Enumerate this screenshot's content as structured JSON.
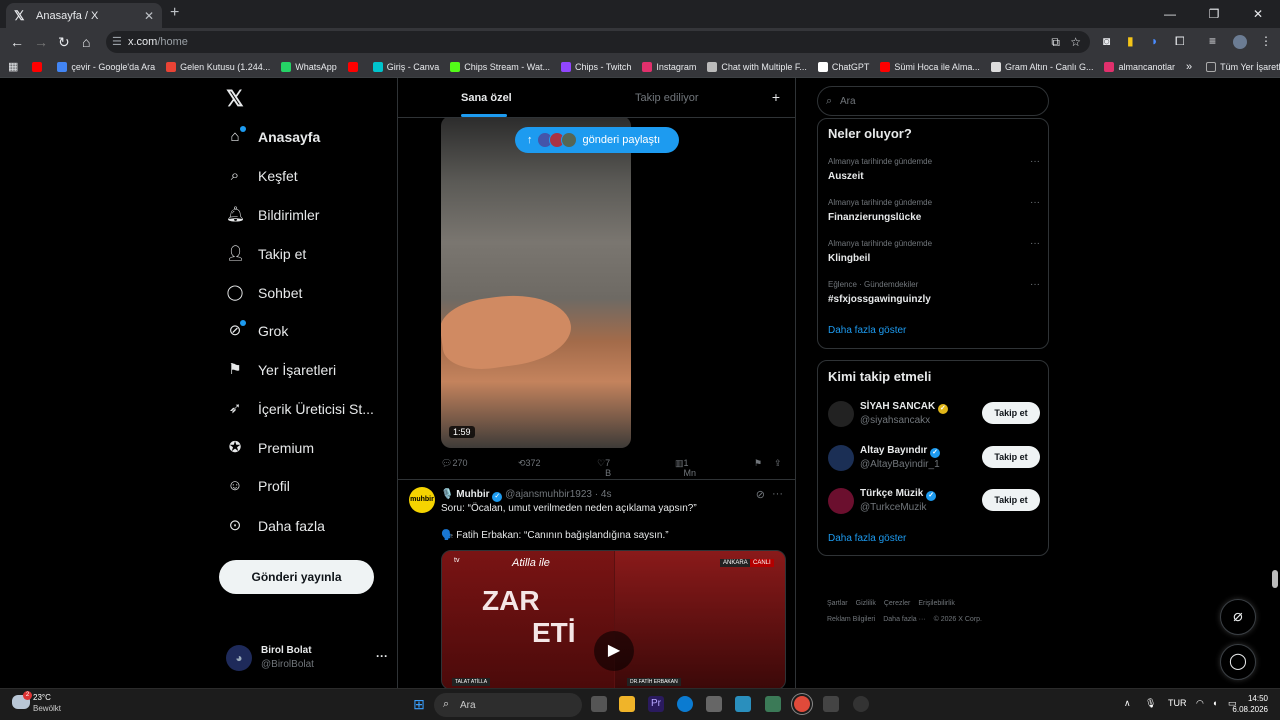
{
  "browser": {
    "tab_title": "Anasayfa / X",
    "url_host": "x.com",
    "url_path": "/home",
    "bookmarks": [
      {
        "label": "",
        "color": "#ff0000"
      },
      {
        "label": "çevir - Google'da Ara",
        "color": "#4285f4"
      },
      {
        "label": "Gelen Kutusu (1.244...",
        "color": "#ea4335"
      },
      {
        "label": "WhatsApp",
        "color": "#25d366"
      },
      {
        "label": "",
        "color": "#ff0000"
      },
      {
        "label": "Giriş - Canva",
        "color": "#00c4cc"
      },
      {
        "label": "Chips Stream - Wat...",
        "color": "#53fc18"
      },
      {
        "label": "Chips - Twitch",
        "color": "#9146ff"
      },
      {
        "label": "Instagram",
        "color": "#e1306c"
      },
      {
        "label": "Chat with Multiple F...",
        "color": "#bbbbbb"
      },
      {
        "label": "ChatGPT",
        "color": "#ffffff"
      },
      {
        "label": "Sümi Hoca ile Alma...",
        "color": "#ff0000"
      },
      {
        "label": "Gram Altın - Canlı G...",
        "color": "#dddddd"
      },
      {
        "label": "almancanotlar",
        "color": "#e1306c"
      }
    ],
    "all_bookmarks_label": "Tüm Yer İşaretleri"
  },
  "nav": {
    "items": [
      {
        "label": "Anasayfa",
        "icon": "home-icon"
      },
      {
        "label": "Keşfet",
        "icon": "search-icon"
      },
      {
        "label": "Bildirimler",
        "icon": "bell-icon"
      },
      {
        "label": "Takip et",
        "icon": "person-add-icon"
      },
      {
        "label": "Sohbet",
        "icon": "chat-icon"
      },
      {
        "label": "Grok",
        "icon": "grok-icon"
      },
      {
        "label": "Yer İşaretleri",
        "icon": "bookmark-icon"
      },
      {
        "label": "İçerik Üreticisi St...",
        "icon": "rocket-icon"
      },
      {
        "label": "Premium",
        "icon": "premium-icon"
      },
      {
        "label": "Profil",
        "icon": "profile-icon"
      },
      {
        "label": "Daha fazla",
        "icon": "more-icon"
      }
    ],
    "post_button": "Gönderi yayınla",
    "user": {
      "name": "Birol Bolat",
      "handle": "@BirolBolat"
    }
  },
  "feed": {
    "tabs": [
      "Sana özel",
      "Takip ediliyor"
    ],
    "new_posts_pill": "gönderi paylaştı",
    "video1_duration": "1:59",
    "actions": {
      "replies": "270",
      "reposts": "372",
      "likes": "7 B",
      "views": "1 Mn"
    },
    "post2": {
      "avatar_text": "muhbir",
      "author": "Muhbir",
      "handle": "@ajansmuhbir1923",
      "time": "· 4s",
      "line1": "Soru: “Öcalan, umut verilmeden neden açıklama yapsın?”",
      "line2": "🗣️ Fatih Erbakan: “Canının bağışlandığına saysın.”",
      "video_overlay_sub": "Atilla ile",
      "video_overlay_big": "ZAR",
      "video_overlay_big2": "ETİ",
      "video_tag_left": "ANKARA",
      "video_tag_right": "CANLI",
      "name_left": "TALAT ATİLLA",
      "name_right": "DR.FATİH ERBAKAN"
    }
  },
  "sidebar": {
    "search_placeholder": "Ara",
    "trends_title": "Neler oluyor?",
    "trends": [
      {
        "category": "Almanya tarihinde gündemde",
        "topic": "Auszeit"
      },
      {
        "category": "Almanya tarihinde gündemde",
        "topic": "Finanzierungslücke"
      },
      {
        "category": "Almanya tarihinde gündemde",
        "topic": "Klingbeil"
      },
      {
        "category": "Eğlence · Gündemdekiler",
        "topic": "#sfxjossgawinguinzly"
      }
    ],
    "show_more": "Daha fazla göster",
    "who_to_follow_title": "Kimi takip etmeli",
    "suggestions": [
      {
        "name": "SİYAH SANCAK",
        "handle": "@siyahsancakx",
        "badge": "gold",
        "avatar_color": "#222"
      },
      {
        "name": "Altay Bayındır",
        "handle": "@AltayBayindir_1",
        "badge": "blue",
        "avatar_color": "#1b2f55"
      },
      {
        "name": "Türkçe Müzik",
        "handle": "@TurkceMuzik",
        "badge": "blue",
        "avatar_color": "#6b0f2e"
      }
    ],
    "follow_label": "Takip et",
    "footer_links": [
      "Şartlar",
      "Gizlilik",
      "Çerezler",
      "Erişilebilirlik",
      "Reklam Bilgileri",
      "Daha fazla ···",
      "© 2026 X Corp."
    ]
  },
  "taskbar": {
    "temp": "23°C",
    "condition": "Bewölkt",
    "search": "Ara",
    "lang": "TUR",
    "time": "14:50",
    "date": "6.08.2026",
    "weather_badge": "2"
  }
}
